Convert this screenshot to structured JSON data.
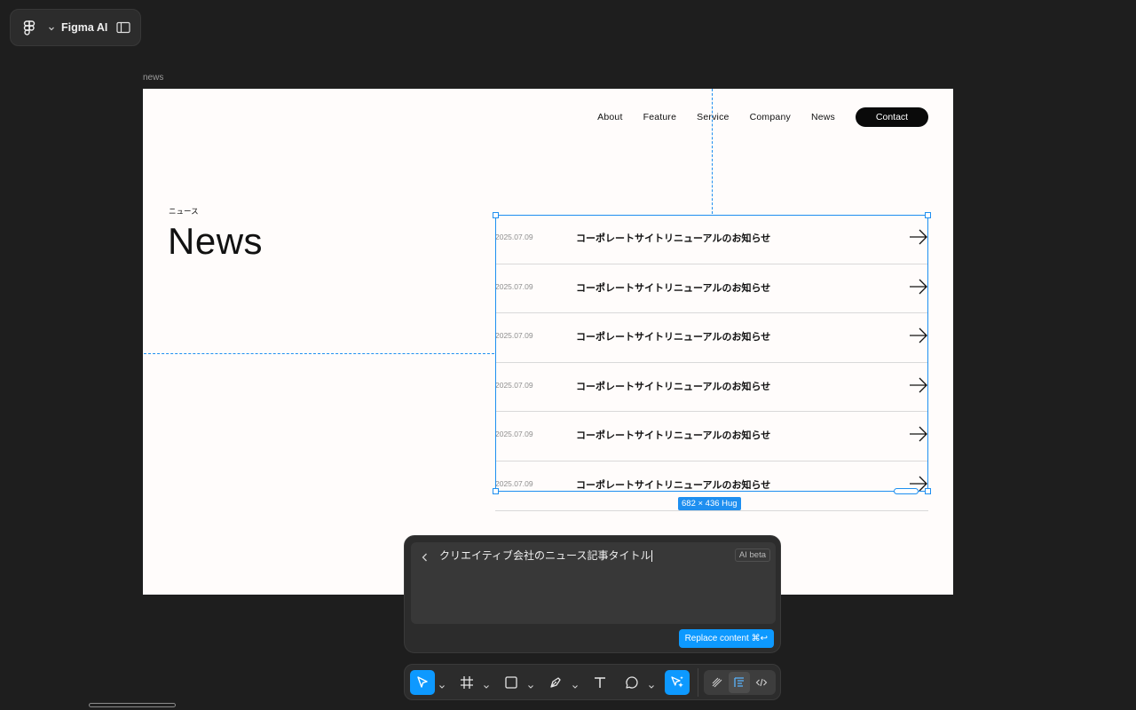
{
  "app": {
    "title": "Figma AI",
    "logo_icon": "figma-logo-icon",
    "panel_icon": "sidebar-toggle-icon"
  },
  "frame": {
    "label": "news",
    "background": "#fffcfb"
  },
  "site": {
    "nav": [
      "About",
      "Feature",
      "Service",
      "Company",
      "News"
    ],
    "contact_label": "Contact",
    "section_label": "ニュース",
    "heading": "News",
    "news_items": [
      {
        "date": "2025.07.09",
        "title": "コーポレートサイトリニューアルのお知らせ"
      },
      {
        "date": "2025.07.09",
        "title": "コーポレートサイトリニューアルのお知らせ"
      },
      {
        "date": "2025.07.09",
        "title": "コーポレートサイトリニューアルのお知らせ"
      },
      {
        "date": "2025.07.09",
        "title": "コーポレートサイトリニューアルのお知らせ"
      },
      {
        "date": "2025.07.09",
        "title": "コーポレートサイトリニューアルのお知らせ"
      },
      {
        "date": "2025.07.09",
        "title": "コーポレートサイトリニューアルのお知らせ"
      }
    ]
  },
  "selection": {
    "size_label": "682 × 436 Hug",
    "color": "#1e8ff0"
  },
  "ai_panel": {
    "prompt": "クリエイティブ会社のニュース記事タイトル",
    "badge": "AI beta",
    "replace_label": "Replace content ⌘↩"
  },
  "toolbar": {
    "tools": [
      "move-tool",
      "frame-tool",
      "shape-tool",
      "pen-tool",
      "text-tool",
      "comment-tool",
      "ai-actions-tool"
    ],
    "modes": [
      "draw-mode",
      "design-mode",
      "dev-mode"
    ],
    "active_color": "#0d99ff"
  }
}
